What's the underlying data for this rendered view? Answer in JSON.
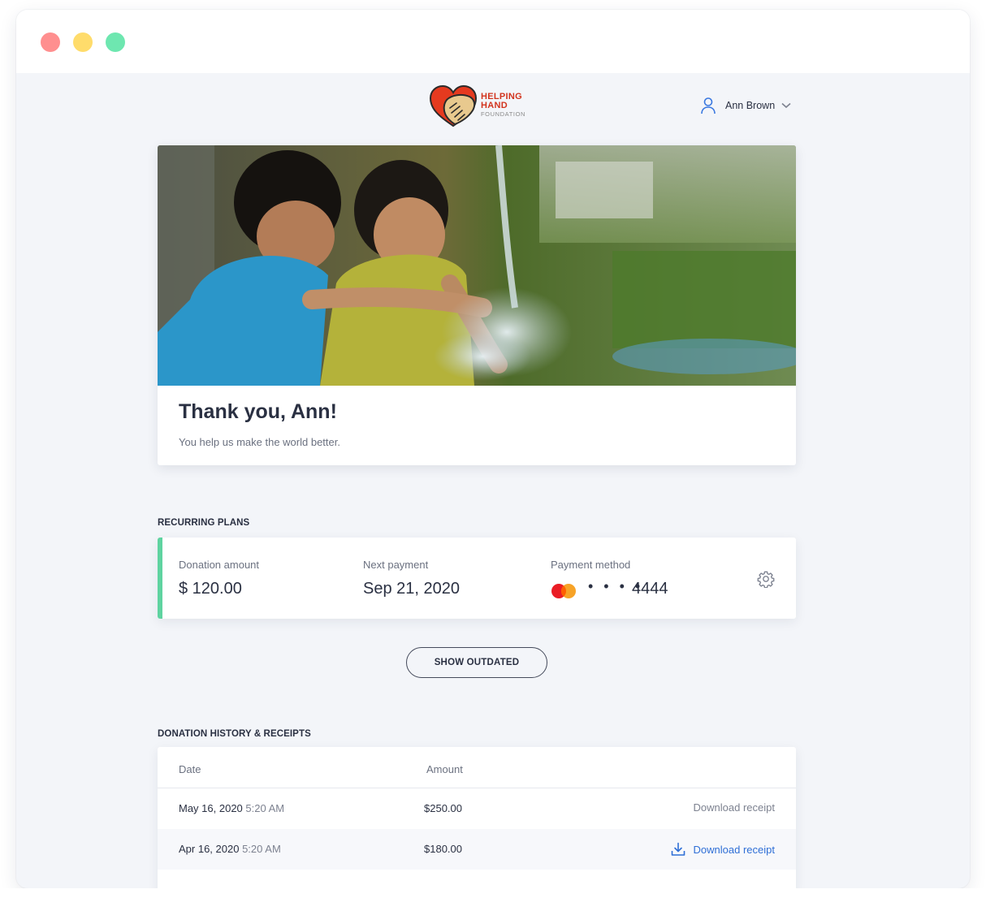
{
  "brand": {
    "line1": "HELPING",
    "line2": "HAND",
    "line3": "FOUNDATION",
    "colors": {
      "red": "#e53a1f",
      "tan": "#e8c98e",
      "accent_green": "#5fd3a0",
      "link_blue": "#2f6fd6"
    }
  },
  "user": {
    "name": "Ann Brown",
    "icon": "user-icon",
    "dropdown_icon": "chevron-down-icon"
  },
  "hero": {
    "title": "Thank you, Ann!",
    "subtitle": "You help us make the world better."
  },
  "recurring": {
    "section_title": "RECURRING PLANS",
    "plan": {
      "amount_label": "Donation amount",
      "amount_value": "$ 120.00",
      "next_label": "Next payment",
      "next_value": "Sep 21, 2020",
      "method_label": "Payment method",
      "card_mask": "• • • •",
      "card_last4": "4444",
      "card_icon": "mastercard-icon",
      "settings_icon": "gear-icon"
    },
    "show_outdated_label": "SHOW OUTDATED"
  },
  "history": {
    "section_title": "DONATION HISTORY & RECEIPTS",
    "columns": {
      "date": "Date",
      "amount": "Amount"
    },
    "rows": [
      {
        "date": "May 16, 2020",
        "time": "5:20 AM",
        "amount": "$250.00",
        "action": "Download receipt"
      },
      {
        "date": "Apr 16, 2020",
        "time": "5:20 AM",
        "amount": "$180.00",
        "action": "Download receipt"
      }
    ]
  }
}
